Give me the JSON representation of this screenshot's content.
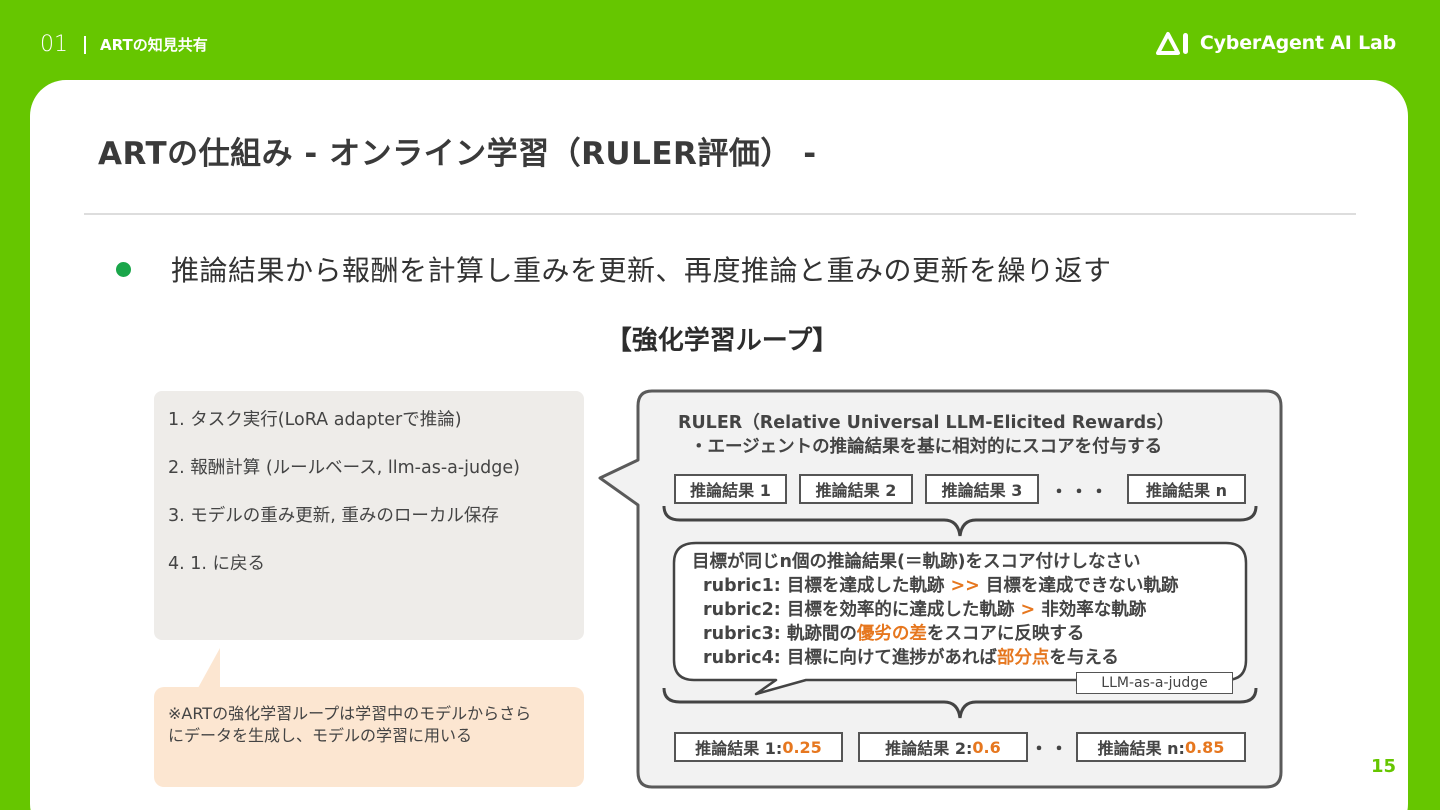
{
  "header": {
    "section_number": "01",
    "section_title": "ARTの知見共有",
    "logo_text": "CyberAgent AI Lab"
  },
  "slide": {
    "title": "ARTの仕組み - オンライン学習（RULER評価） -",
    "bullet": "推論結果から報酬を計算し重みを更新、再度推論と重みの更新を繰り返す",
    "section_heading": "【強化学習ループ】",
    "steps": [
      "1. タスク実行(LoRA adapterで推論)",
      "2. 報酬計算 (ルールベース, llm-as-a-judge)",
      "3. モデルの重み更新, 重みのローカル保存",
      "4. 1. に戻る"
    ],
    "note": [
      "※ARTの強化学習ループは学習中のモデルからさら",
      "にデータを生成し、モデルの学習に用いる"
    ],
    "ruler": {
      "title": "RULER（Relative Universal LLM-Elicited Rewards）",
      "subtitle": "・エージェントの推論結果を基に相対的にスコアを付与する",
      "results": [
        "推論結果 1",
        "推論結果 2",
        "推論結果 3",
        "推論結果 n"
      ],
      "ellipsis": "・・・",
      "prompt": {
        "line1": "目標が同じn個の推論結果(＝軌跡)をスコア付けしなさい",
        "r1_a": "rubric1: 目標を達成した軌跡 ",
        "r1_op": ">>",
        "r1_b": " 目標を達成できない軌跡",
        "r2_a": "rubric2: 目標を効率的に達成した軌跡 ",
        "r2_op": ">",
        "r2_b": " 非効率な軌跡",
        "r3_a": "rubric3: 軌跡間の",
        "r3_hl": "優劣の差",
        "r3_b": "をスコアに反映する",
        "r4_a": "rubric4: 目標に向けて進捗があれば",
        "r4_hl": "部分点",
        "r4_b": "を与える"
      },
      "judge_label": "LLM-as-a-judge",
      "scores": [
        {
          "label": "推論結果 1: ",
          "value": "0.25"
        },
        {
          "label": "推論結果 2: ",
          "value": "0.6"
        },
        {
          "label": "推論結果 n: ",
          "value": "0.85"
        }
      ]
    },
    "page_number": "15"
  },
  "colors": {
    "brand_green": "#66c600",
    "bullet_green": "#1aa64a",
    "highlight_orange": "#e6771f",
    "steps_bg": "#eeece9",
    "note_bg": "#fce6d1"
  }
}
